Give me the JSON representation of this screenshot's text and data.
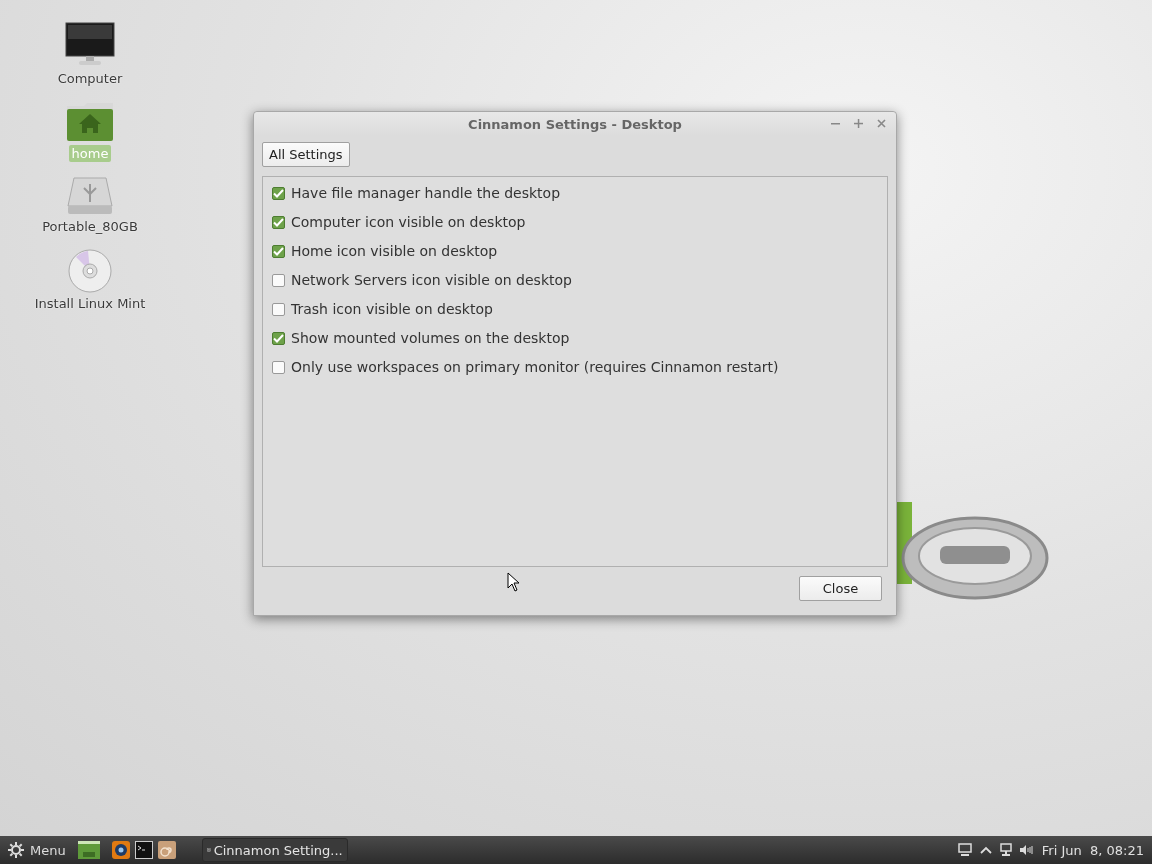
{
  "desktop_icons": [
    {
      "label": "Computer",
      "kind": "monitor",
      "selected": false
    },
    {
      "label": "home",
      "kind": "folder",
      "selected": true
    },
    {
      "label": "Portable_80GB",
      "kind": "usb",
      "selected": false
    },
    {
      "label": "Install Linux Mint",
      "kind": "disc",
      "selected": false
    }
  ],
  "window": {
    "title": "Cinnamon Settings - Desktop",
    "all_settings_button": "All Settings",
    "options": [
      {
        "label": "Have file manager handle the desktop",
        "checked": true
      },
      {
        "label": "Computer icon visible on desktop",
        "checked": true
      },
      {
        "label": "Home icon visible on desktop",
        "checked": true
      },
      {
        "label": "Network Servers icon visible on desktop",
        "checked": false
      },
      {
        "label": "Trash icon visible on desktop",
        "checked": false
      },
      {
        "label": "Show mounted volumes on the desktop",
        "checked": true
      },
      {
        "label": "Only use workspaces on primary monitor (requires Cinnamon restart)",
        "checked": false
      }
    ],
    "close_button": "Close"
  },
  "taskbar": {
    "menu_label": "Menu",
    "window_buttons": [
      {
        "label": "Cinnamon Setting..."
      }
    ],
    "clock": "Fri Jun  8, 08:21"
  }
}
